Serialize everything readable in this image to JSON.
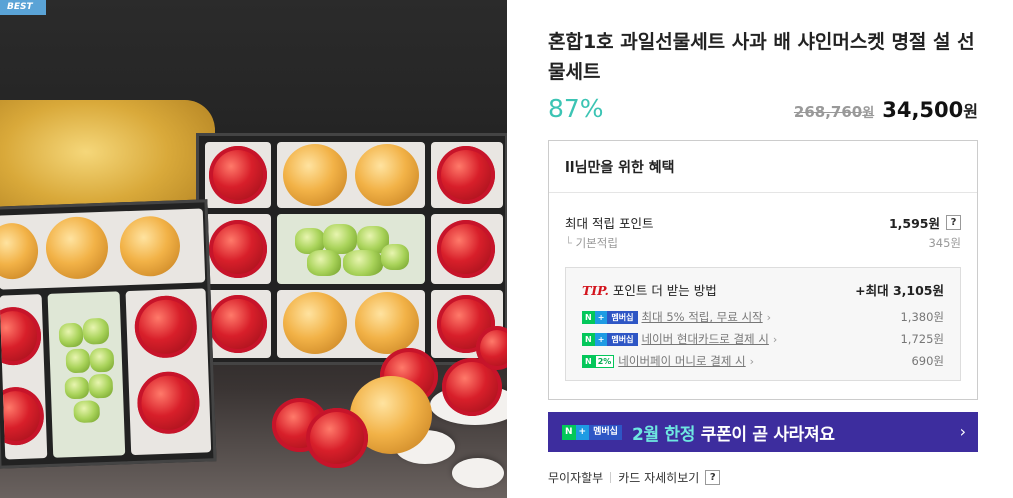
{
  "badge": {
    "label": "BEST"
  },
  "product": {
    "title": "혼합1호 과일선물세트 사과 배 샤인머스켓 명절 설 선물세트",
    "discount_rate": "87%",
    "original_price": "268,760",
    "original_unit": "원",
    "sale_price": "34,500",
    "sale_unit": "원"
  },
  "benefits": {
    "heading": "ll님만을 위한 혜택",
    "max_points_label": "최대 적립 포인트",
    "max_points_value": "1,595원",
    "help_label": "?",
    "base_label": "기본적립",
    "base_value": "345원",
    "tip": {
      "tag": "TIP.",
      "label": "포인트 더 받는 방법",
      "max": "+최대 3,105원",
      "rows": [
        {
          "badge_n": "N",
          "badge_plus": "+",
          "badge_text": "멤버십",
          "text": "최대 5% 적립, 무료 시작",
          "value": "1,380원"
        },
        {
          "badge_n": "N",
          "badge_plus": "+",
          "badge_text": "멤버십",
          "text": "네이버 현대카드로 결제 시",
          "value": "1,725원"
        },
        {
          "badge_n": "N",
          "badge_pct": "2%",
          "text": "네이버페이 머니로 결제 시",
          "value": "690원"
        }
      ]
    }
  },
  "promo": {
    "badge_n": "N",
    "badge_plus": "+",
    "badge_text": "멤버십",
    "highlight": "2월 한정",
    "text": " 쿠폰이 곧 사라져요",
    "arrow": "›"
  },
  "links": {
    "installment": "무이자할부",
    "card_detail": "카드 자세히보기",
    "help": "?"
  },
  "colors": {
    "discount": "#3cc4b4",
    "promo_bg": "#3d2d9e",
    "tip_red": "#d3141d",
    "naver_green": "#03c75a"
  }
}
